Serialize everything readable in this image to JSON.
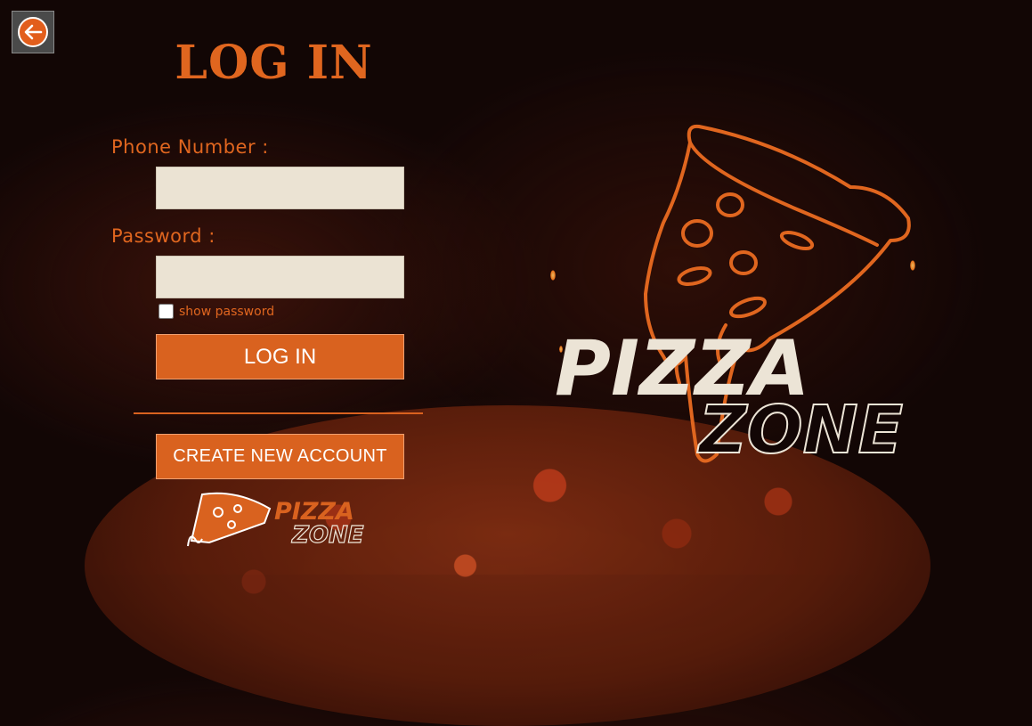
{
  "header": {
    "title": "LOG IN"
  },
  "form": {
    "phone_label": "Phone Number :",
    "phone_value": "",
    "password_label": "Password :",
    "password_value": "",
    "show_password_label": "show password",
    "show_password_checked": false,
    "login_button": "LOG IN",
    "create_account_button": "CREATE NEW ACCOUNT"
  },
  "branding": {
    "logo_word1": "PIZZA",
    "logo_word2": "ZONE"
  },
  "icons": {
    "back": "back-arrow-icon"
  },
  "colors": {
    "accent": "#d9621f",
    "accent_text": "#e0661f",
    "field_bg": "#ebe3d3",
    "logo_light": "#ece4d6"
  }
}
